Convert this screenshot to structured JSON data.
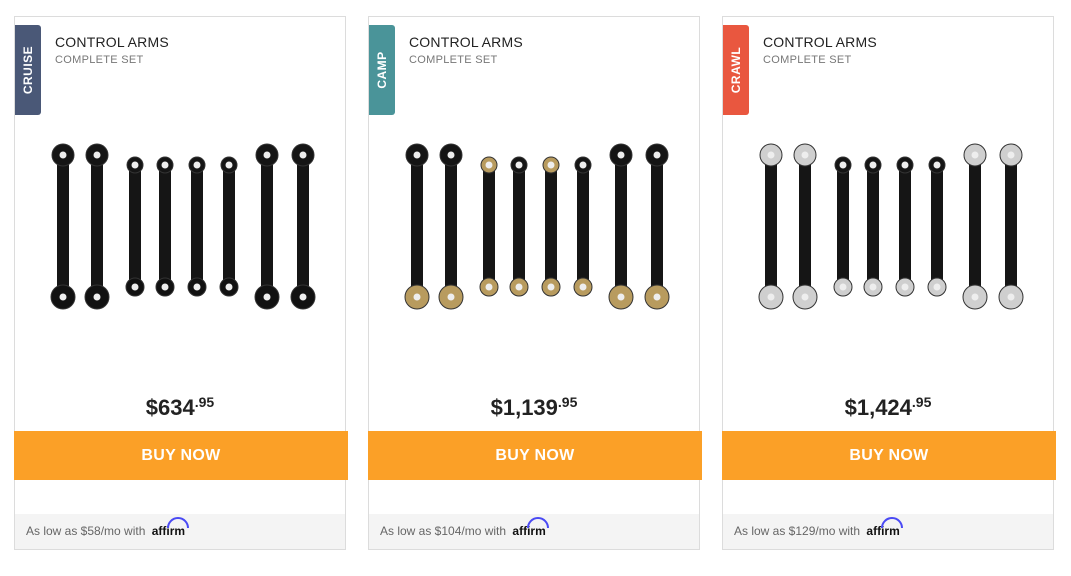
{
  "cards": [
    {
      "tag": "CRUISE",
      "tag_color": "#4a5877",
      "title": "CONTROL ARMS",
      "subtitle": "COMPLETE SET",
      "price_main": "$634",
      "price_cents": ".95",
      "buy_label": "BUY NOW",
      "finance_text": "As low as $58/mo with",
      "finance_brand": "affirm",
      "image_icon": "control-arms-set-cruise",
      "end_style": "black"
    },
    {
      "tag": "CAMP",
      "tag_color": "#4a9499",
      "title": "CONTROL ARMS",
      "subtitle": "COMPLETE SET",
      "price_main": "$1,139",
      "price_cents": ".95",
      "buy_label": "BUY NOW",
      "finance_text": "As low as $104/mo with",
      "finance_brand": "affirm",
      "image_icon": "control-arms-set-camp",
      "end_style": "gold"
    },
    {
      "tag": "CRAWL",
      "tag_color": "#e9573f",
      "title": "CONTROL ARMS",
      "subtitle": "COMPLETE SET",
      "price_main": "$1,424",
      "price_cents": ".95",
      "buy_label": "BUY NOW",
      "finance_text": "As low as $129/mo with",
      "finance_brand": "affirm",
      "image_icon": "control-arms-set-crawl",
      "end_style": "silver"
    }
  ],
  "colors": {
    "buy_button": "#fba027",
    "affirm_arc": "#4a4af4"
  }
}
